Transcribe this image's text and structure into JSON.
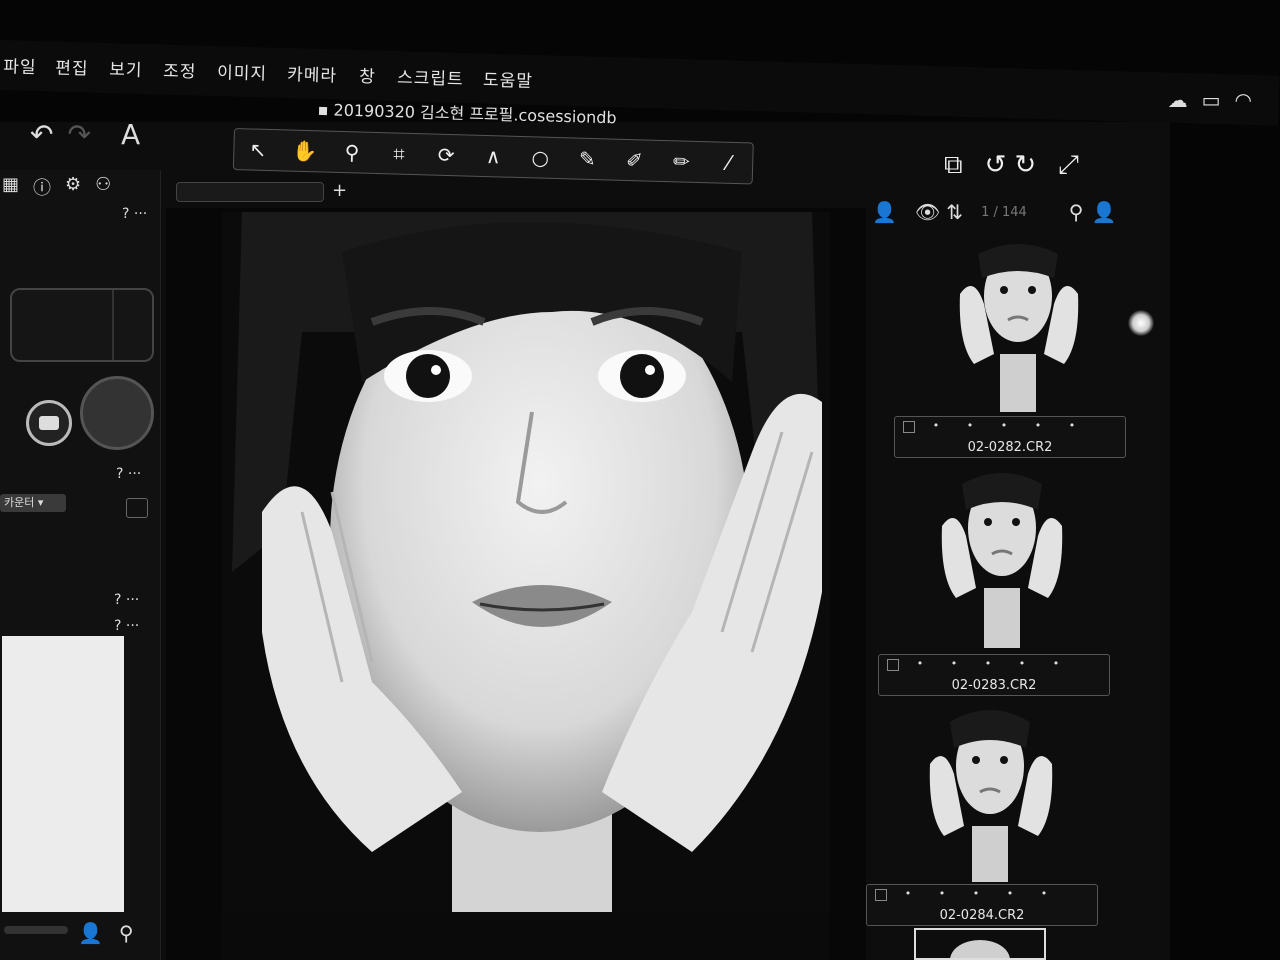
{
  "menu": {
    "items": [
      "파일",
      "편집",
      "보기",
      "조정",
      "이미지",
      "카메라",
      "창",
      "스크립트",
      "도움말"
    ]
  },
  "window": {
    "title": "20190320 김소현 프로필.cosessiondb"
  },
  "toolbar": {
    "text_tool_label": "A"
  },
  "viewer": {
    "counter": "1 / 144"
  },
  "left_panel": {
    "help_label": "?",
    "more_label": "···",
    "counter_dropdown_label": "카운터"
  },
  "browser": {
    "thumbnails": [
      {
        "filename": "02-0282.CR2",
        "rating_stars": "• • • • •"
      },
      {
        "filename": "02-0283.CR2",
        "rating_stars": "• • • • •"
      },
      {
        "filename": "02-0284.CR2",
        "rating_stars": "• • • • •"
      }
    ]
  },
  "icons": {
    "status": [
      "creative-cloud-icon",
      "display-icon",
      "wifi-icon"
    ],
    "tools": [
      "select-icon",
      "pan-icon",
      "zoom-icon",
      "crop-icon",
      "rotate-icon",
      "straighten-icon",
      "spot-icon",
      "picker-icon",
      "brush-icon",
      "eraser-icon",
      "gradient-icon"
    ]
  },
  "colors": {
    "background": "#050505",
    "panel": "#111111",
    "text": "#e6e6e6"
  }
}
